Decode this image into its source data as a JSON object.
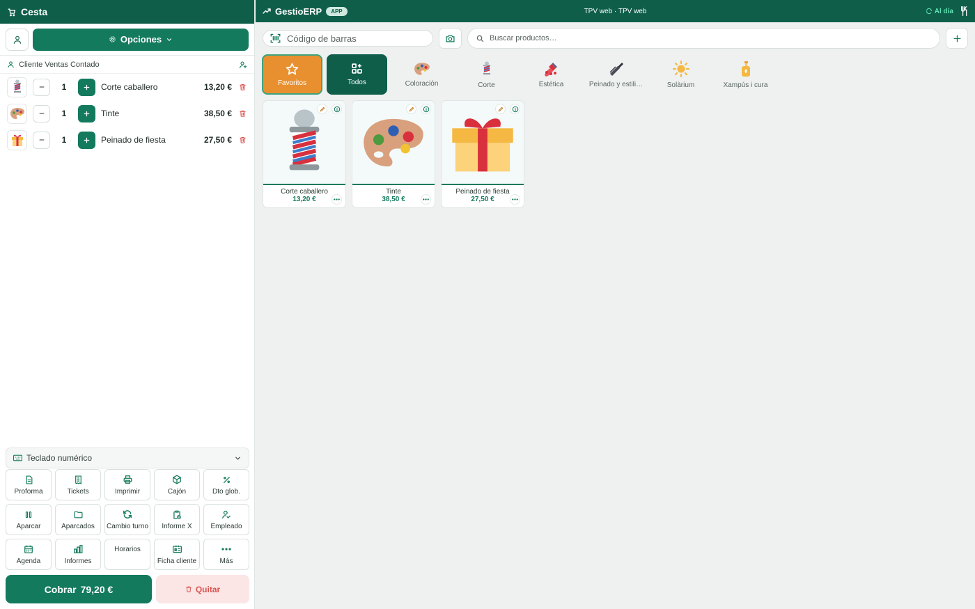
{
  "cart": {
    "title": "Cesta",
    "options_label": "Opciones",
    "client_label": "Cliente Ventas Contado",
    "items": [
      {
        "name": "Corte caballero",
        "qty": "1",
        "price": "13,20 €",
        "icon": "barber-pole-icon"
      },
      {
        "name": "Tinte",
        "qty": "1",
        "price": "38,50 €",
        "icon": "palette-icon"
      },
      {
        "name": "Peinado de fiesta",
        "qty": "1",
        "price": "27,50 €",
        "icon": "gift-icon"
      }
    ],
    "keypad_label": "Teclado numérico",
    "functions": [
      {
        "label": "Proforma",
        "icon": "document-icon"
      },
      {
        "label": "Tickets",
        "icon": "receipt-icon"
      },
      {
        "label": "Imprimir",
        "icon": "printer-icon"
      },
      {
        "label": "Cajón",
        "icon": "box-icon"
      },
      {
        "label": "Dto glob.",
        "icon": "percent-icon"
      },
      {
        "label": "Aparcar",
        "icon": "pause-icon"
      },
      {
        "label": "Aparcados",
        "icon": "folder-icon"
      },
      {
        "label": "Cambio turno",
        "icon": "refresh-icon"
      },
      {
        "label": "Informe X",
        "icon": "clipboard-clock-icon"
      },
      {
        "label": "Empleado",
        "icon": "user-check-icon"
      },
      {
        "label": "Agenda",
        "icon": "calendar-icon"
      },
      {
        "label": "Informes",
        "icon": "bar-chart-icon"
      },
      {
        "label": "Horarios",
        "icon": ""
      },
      {
        "label": "Ficha cliente",
        "icon": "contact-card-icon"
      },
      {
        "label": "Más",
        "icon": "more-icon"
      }
    ],
    "charge_label": "Cobrar",
    "charge_total": "79,20 €",
    "remove_label": "Quitar"
  },
  "topbar": {
    "brand": "GestioERP",
    "badge": "APP",
    "center_title": "TPV web · TPV web",
    "sync_status": "Al día"
  },
  "search": {
    "barcode_placeholder": "Código de barras",
    "product_placeholder": "Buscar productos…"
  },
  "categories": [
    {
      "label": "Favoritos",
      "icon": "star-icon",
      "state": "selected"
    },
    {
      "label": "Todos",
      "icon": "grid-plus-icon",
      "state": "active"
    },
    {
      "label": "Coloración",
      "icon": "palette-icon"
    },
    {
      "label": "Corte",
      "icon": "barber-pole-icon"
    },
    {
      "label": "Estética",
      "icon": "nail-polish-icon"
    },
    {
      "label": "Peinado y estili…",
      "icon": "comb-icon"
    },
    {
      "label": "Solàrium",
      "icon": "sun-icon"
    },
    {
      "label": "Xampús i cura",
      "icon": "lotion-icon"
    }
  ],
  "products": [
    {
      "name": "Corte caballero",
      "price": "13,20 €",
      "icon": "barber-pole-icon"
    },
    {
      "name": "Tinte",
      "price": "38,50 €",
      "icon": "palette-icon"
    },
    {
      "name": "Peinado de fiesta",
      "price": "27,50 €",
      "icon": "gift-icon"
    }
  ],
  "colors": {
    "brand_dark": "#0e5e4a",
    "brand": "#137a5d",
    "favorite": "#e8902f",
    "danger": "#d9534f"
  }
}
